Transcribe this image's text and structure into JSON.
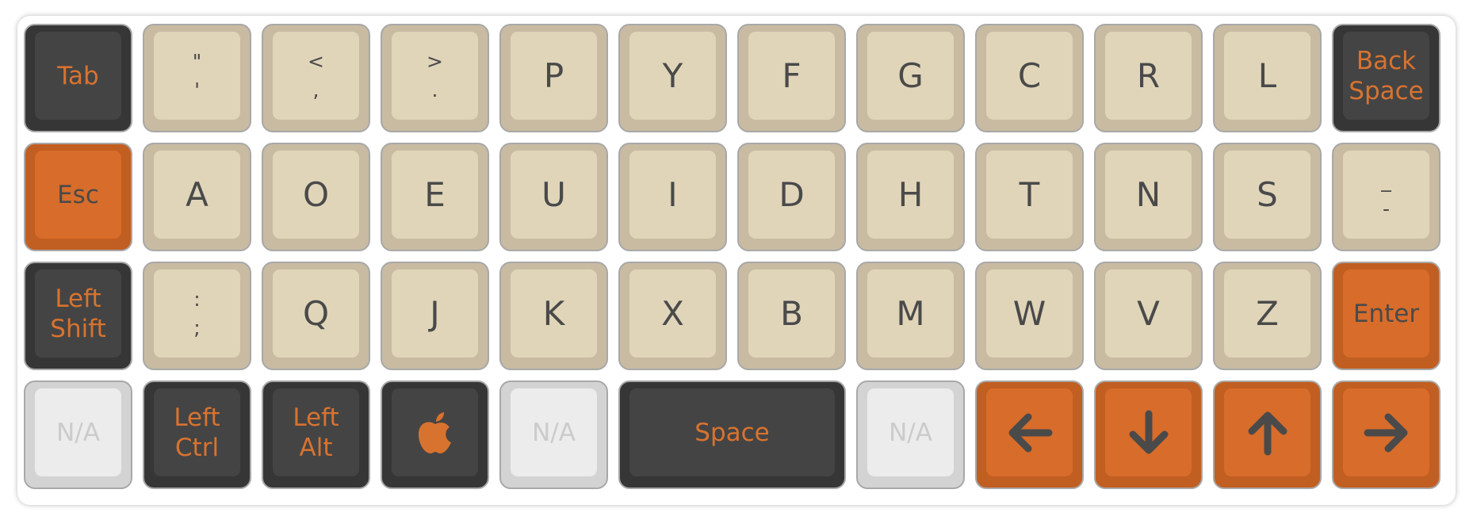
{
  "keyboard": {
    "rows": [
      [
        {
          "id": "tab",
          "style": "dark",
          "label": "Tab"
        },
        {
          "id": "quote",
          "style": "beige",
          "shift": "\"",
          "base": "'"
        },
        {
          "id": "comma",
          "style": "beige",
          "shift": "<",
          "base": ","
        },
        {
          "id": "period",
          "style": "beige",
          "shift": ">",
          "base": "."
        },
        {
          "id": "p",
          "style": "beige",
          "label": "P"
        },
        {
          "id": "y",
          "style": "beige",
          "label": "Y"
        },
        {
          "id": "f",
          "style": "beige",
          "label": "F"
        },
        {
          "id": "g",
          "style": "beige",
          "label": "G"
        },
        {
          "id": "c",
          "style": "beige",
          "label": "C"
        },
        {
          "id": "r",
          "style": "beige",
          "label": "R"
        },
        {
          "id": "l",
          "style": "beige",
          "label": "L"
        },
        {
          "id": "backspace",
          "style": "dark",
          "label": "Back Space"
        }
      ],
      [
        {
          "id": "esc",
          "style": "orange",
          "label": "Esc"
        },
        {
          "id": "a",
          "style": "beige",
          "label": "A"
        },
        {
          "id": "o",
          "style": "beige",
          "label": "O"
        },
        {
          "id": "e",
          "style": "beige",
          "label": "E"
        },
        {
          "id": "u",
          "style": "beige",
          "label": "U"
        },
        {
          "id": "i",
          "style": "beige",
          "label": "I"
        },
        {
          "id": "d",
          "style": "beige",
          "label": "D"
        },
        {
          "id": "h",
          "style": "beige",
          "label": "H"
        },
        {
          "id": "t",
          "style": "beige",
          "label": "T"
        },
        {
          "id": "n",
          "style": "beige",
          "label": "N"
        },
        {
          "id": "s",
          "style": "beige",
          "label": "S"
        },
        {
          "id": "minus",
          "style": "beige",
          "shift": "_",
          "base": "-"
        }
      ],
      [
        {
          "id": "left-shift",
          "style": "dark",
          "label": "Left Shift"
        },
        {
          "id": "semicolon",
          "style": "beige",
          "shift": ":",
          "base": ";"
        },
        {
          "id": "q",
          "style": "beige",
          "label": "Q"
        },
        {
          "id": "j",
          "style": "beige",
          "label": "J"
        },
        {
          "id": "k",
          "style": "beige",
          "label": "K"
        },
        {
          "id": "x",
          "style": "beige",
          "label": "X"
        },
        {
          "id": "b",
          "style": "beige",
          "label": "B"
        },
        {
          "id": "m",
          "style": "beige",
          "label": "M"
        },
        {
          "id": "w",
          "style": "beige",
          "label": "W"
        },
        {
          "id": "v",
          "style": "beige",
          "label": "V"
        },
        {
          "id": "z",
          "style": "beige",
          "label": "Z"
        },
        {
          "id": "enter",
          "style": "orange",
          "label": "Enter"
        }
      ],
      [
        {
          "id": "na-1",
          "style": "na",
          "label": "N/A"
        },
        {
          "id": "left-ctrl",
          "style": "dark",
          "label": "Left Ctrl"
        },
        {
          "id": "left-alt",
          "style": "dark",
          "label": "Left Alt"
        },
        {
          "id": "command",
          "style": "dark",
          "icon": "apple-icon"
        },
        {
          "id": "na-2",
          "style": "na",
          "label": "N/A"
        },
        {
          "id": "space",
          "style": "dark",
          "label": "Space",
          "wide": true
        },
        {
          "id": "na-3",
          "style": "na",
          "label": "N/A"
        },
        {
          "id": "left-arrow",
          "style": "orange",
          "icon": "arrow-left-icon"
        },
        {
          "id": "down-arrow",
          "style": "orange",
          "icon": "arrow-down-icon"
        },
        {
          "id": "up-arrow",
          "style": "orange",
          "icon": "arrow-up-icon"
        },
        {
          "id": "right-arrow",
          "style": "orange",
          "icon": "arrow-right-icon"
        }
      ]
    ],
    "colors": {
      "beige_cap": "#e0d5b9",
      "beige_base": "#c8bba2",
      "dark_cap": "#444444",
      "orange_cap": "#d86c2a",
      "legend_orange": "#d8732f",
      "legend_dark": "#4a4a4a",
      "na_cap": "#ececec"
    }
  }
}
